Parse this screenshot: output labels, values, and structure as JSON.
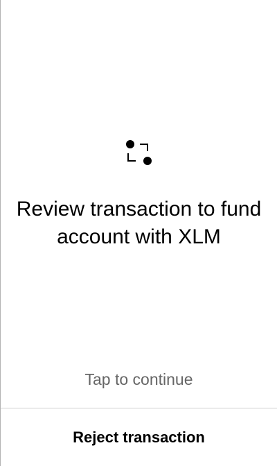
{
  "screen": {
    "icon": "flow-connector-icon",
    "title": "Review transaction to fund account with XLM",
    "tap_hint": "Tap to continue"
  },
  "footer": {
    "reject_label": "Reject transaction"
  },
  "colors": {
    "background": "#ffffff",
    "text": "#000000",
    "hint_text": "#666666",
    "divider": "#cfcfcf"
  }
}
